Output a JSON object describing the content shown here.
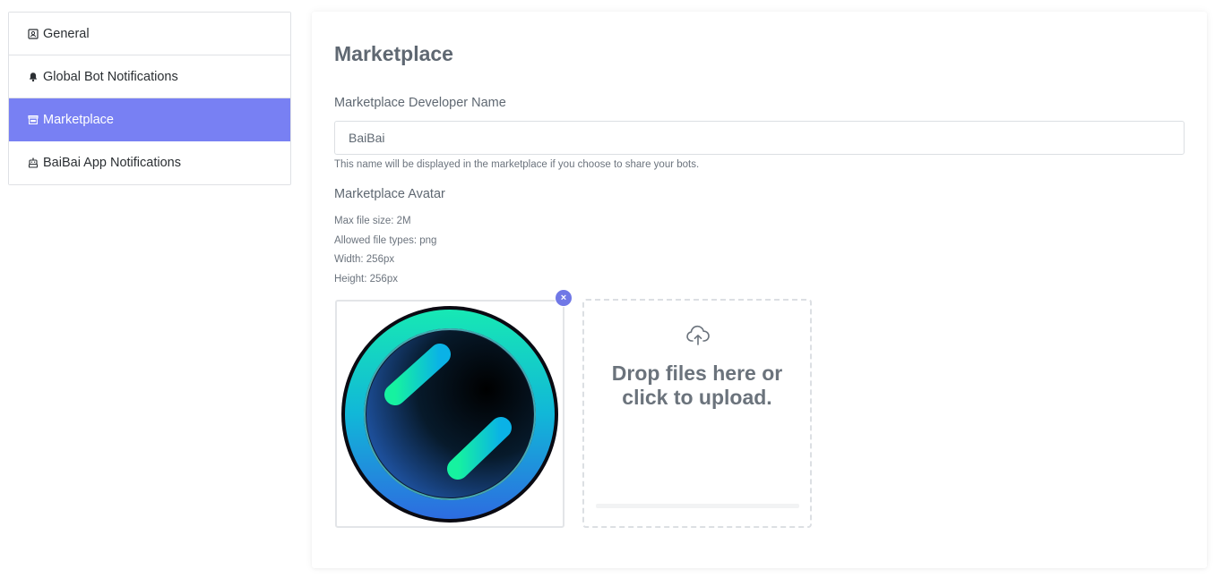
{
  "sidebar": {
    "items": [
      {
        "label": "General",
        "icon": "id-card-icon",
        "active": false
      },
      {
        "label": "Global Bot Notifications",
        "icon": "bell-icon",
        "active": false
      },
      {
        "label": "Marketplace",
        "icon": "store-icon",
        "active": true
      },
      {
        "label": "BaiBai App Notifications",
        "icon": "robot-icon",
        "active": false
      }
    ]
  },
  "main": {
    "title": "Marketplace",
    "developer_name": {
      "label": "Marketplace Developer Name",
      "value": "BaiBai",
      "help": "This name will be displayed in the marketplace if you choose to share your bots."
    },
    "avatar": {
      "label": "Marketplace Avatar",
      "max_size": "Max file size: 2M",
      "file_types": "Allowed file types: png",
      "width": "Width: 256px",
      "height": "Height: 256px",
      "remove_label": "×",
      "dropzone_line1": "Drop files here or",
      "dropzone_line2": "click to upload.",
      "dropzone_icon": "cloud-upload-icon"
    }
  },
  "colors": {
    "accent": "#7880f3",
    "remove_button": "#7078e6"
  }
}
